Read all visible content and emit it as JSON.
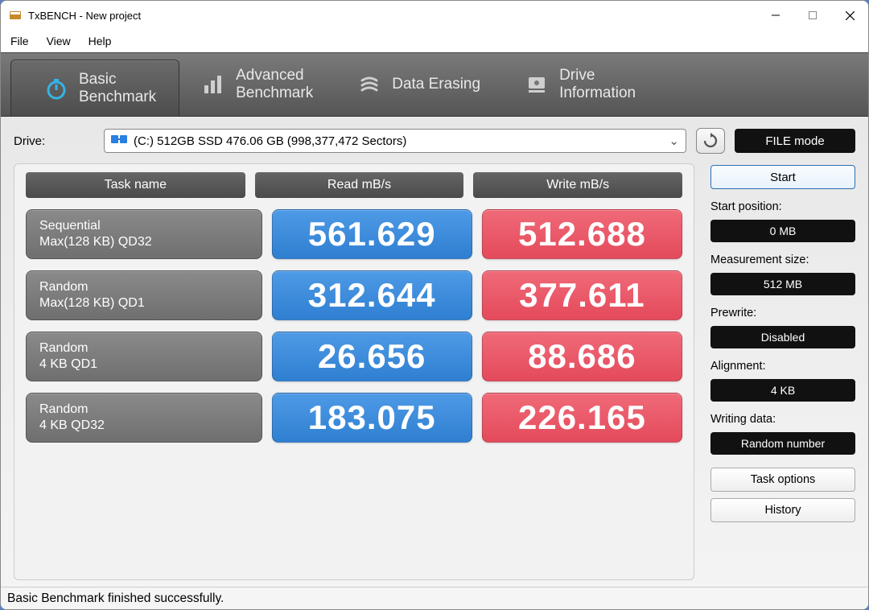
{
  "window": {
    "title": "TxBENCH - New project"
  },
  "menu": {
    "file": "File",
    "view": "View",
    "help": "Help"
  },
  "tabs": {
    "basic": {
      "line1": "Basic",
      "line2": "Benchmark"
    },
    "advanced": {
      "line1": "Advanced",
      "line2": "Benchmark"
    },
    "erasing": {
      "line1": "Data Erasing",
      "line2": ""
    },
    "driveinfo": {
      "line1": "Drive",
      "line2": "Information"
    }
  },
  "drive": {
    "label": "Drive:",
    "value": "(C:) 512GB SSD  476.06 GB (998,377,472 Sectors)",
    "filemode": "FILE mode"
  },
  "headers": {
    "task": "Task name",
    "read": "Read mB/s",
    "write": "Write mB/s"
  },
  "rows": [
    {
      "name1": "Sequential",
      "name2": "Max(128 KB) QD32",
      "read": "561.629",
      "write": "512.688"
    },
    {
      "name1": "Random",
      "name2": "Max(128 KB) QD1",
      "read": "312.644",
      "write": "377.611"
    },
    {
      "name1": "Random",
      "name2": "4 KB QD1",
      "read": "26.656",
      "write": "88.686"
    },
    {
      "name1": "Random",
      "name2": "4 KB QD32",
      "read": "183.075",
      "write": "226.165"
    }
  ],
  "side": {
    "start": "Start",
    "startpos_label": "Start position:",
    "startpos_value": "0 MB",
    "meassize_label": "Measurement size:",
    "meassize_value": "512 MB",
    "prewrite_label": "Prewrite:",
    "prewrite_value": "Disabled",
    "align_label": "Alignment:",
    "align_value": "4 KB",
    "wdata_label": "Writing data:",
    "wdata_value": "Random number",
    "taskopts": "Task options",
    "history": "History"
  },
  "status": "Basic Benchmark finished successfully."
}
